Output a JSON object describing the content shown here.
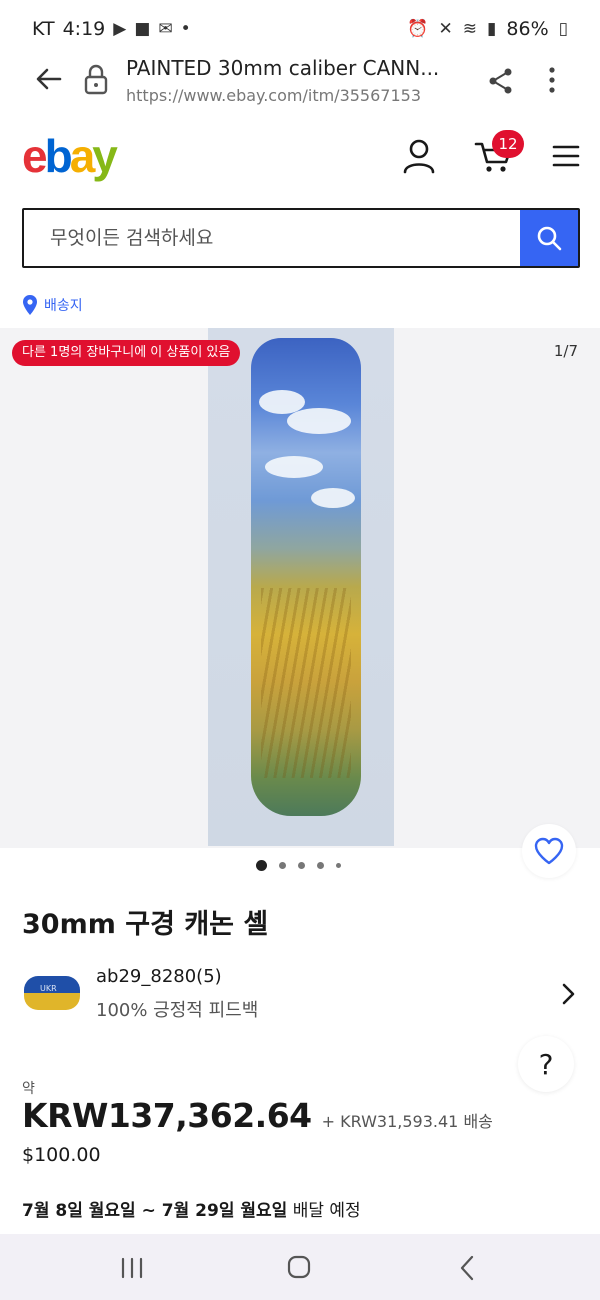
{
  "status_bar": {
    "carrier": "KT",
    "time": "4:19",
    "battery": "86%",
    "left_icons": [
      "youtube-icon",
      "video-icon",
      "mail-icon",
      "dot-icon"
    ],
    "right_icons": [
      "alarm-icon",
      "mute-icon",
      "wifi-icon",
      "signal-icon",
      "battery-icon"
    ]
  },
  "browser": {
    "page_title": "PAINTED 30mm caliber CANN...",
    "url": "https://www.ebay.com/itm/35567153",
    "icons": [
      "back-arrow-icon",
      "lock-icon",
      "share-icon",
      "more-vertical-icon"
    ]
  },
  "header": {
    "logo": {
      "e": "e",
      "b": "b",
      "a": "a",
      "y": "y"
    },
    "cart_count": "12",
    "brand_colors": {
      "red": "#e53238",
      "blue": "#0064d2",
      "yellow": "#f5af02",
      "green": "#86b817"
    }
  },
  "search": {
    "placeholder": "무엇이든 검색하세요",
    "button_color": "#3665f3"
  },
  "ship_to": {
    "label": "배송지"
  },
  "gallery": {
    "badge": "다른 1명의 장바구니에 이 상품이 있음",
    "counter": "1/7",
    "dots": 5,
    "active_dot": 1
  },
  "item": {
    "title": "30mm 구경 캐논 셸"
  },
  "seller": {
    "avatar_text": "UKR",
    "name": "ab29_8280(5)",
    "feedback": "100% 긍정적 피드백"
  },
  "help": {
    "label": "?"
  },
  "price": {
    "prefix": "약",
    "amount": "KRW137,362.64",
    "shipping": "+ KRW31,593.41 배송",
    "usd": "$100.00"
  },
  "delivery": {
    "start": "7월 8일 월요일",
    "separator": " ~ ",
    "end": "7월 29일 월요일",
    "suffix": " 배달 예정"
  },
  "nav_bar": {
    "icons": [
      "recent-apps-icon",
      "home-icon",
      "back-icon"
    ]
  }
}
